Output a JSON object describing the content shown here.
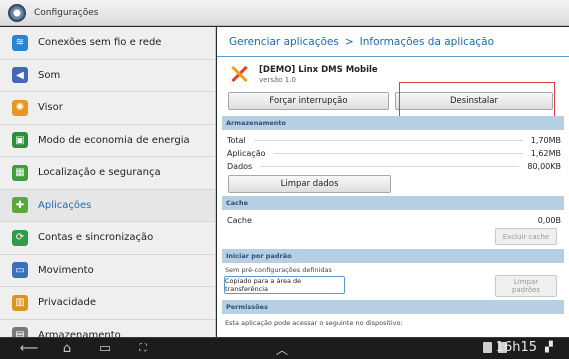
{
  "window": {
    "title": "Configurações"
  },
  "sidebar": {
    "items": [
      {
        "label": "Conexões sem fio e rede",
        "icon": "wifi-icon",
        "color": "#2a84d2",
        "glyph": "≋"
      },
      {
        "label": "Som",
        "icon": "speaker-icon",
        "color": "#4468b8",
        "glyph": "◀"
      },
      {
        "label": "Visor",
        "icon": "brightness-icon",
        "color": "#e8951d",
        "glyph": "✺"
      },
      {
        "label": "Modo de economia de energia",
        "icon": "power-save-icon",
        "color": "#2d8f3b",
        "glyph": "▣"
      },
      {
        "label": "Localização e segurança",
        "icon": "location-security-icon",
        "color": "#3f9d3a",
        "glyph": "▦"
      },
      {
        "label": "Aplicações",
        "icon": "applications-icon",
        "color": "#5aa83b",
        "glyph": "✚"
      },
      {
        "label": "Contas e sincronização",
        "icon": "sync-icon",
        "color": "#2f9c4a",
        "glyph": "⟳"
      },
      {
        "label": "Movimento",
        "icon": "motion-icon",
        "color": "#3b6fb8",
        "glyph": "▭"
      },
      {
        "label": "Privacidade",
        "icon": "privacy-icon",
        "color": "#d9951e",
        "glyph": "▥"
      },
      {
        "label": "Armazenamento",
        "icon": "storage-icon",
        "color": "#7a7a7a",
        "glyph": "▤"
      }
    ]
  },
  "breadcrumb": {
    "parent": "Gerenciar aplicações",
    "separator": ">",
    "current": "Informações da aplicação"
  },
  "app": {
    "name": "[DEMO] Linx DMS Mobile",
    "version": "versão 1.0"
  },
  "buttons": {
    "force_stop": "Forçar interrupção",
    "uninstall": "Desinstalar",
    "clear_data": "Limpar dados",
    "clear_cache": "Excluir cache",
    "copy_clipboard": "Copiado para a área de transferência",
    "clear_defaults": "Limpar padrões"
  },
  "storage": {
    "header": "Armazenamento",
    "rows": [
      {
        "label": "Total",
        "value": "1,70MB"
      },
      {
        "label": "Aplicação",
        "value": "1,62MB"
      },
      {
        "label": "Dados",
        "value": "80,00KB"
      }
    ]
  },
  "cache": {
    "header": "Cache",
    "label": "Cache",
    "value": "0,00B"
  },
  "defaults": {
    "header": "Iniciar por padrão",
    "note": "Sem pré-configurações definidas"
  },
  "permissions": {
    "header": "Permissões",
    "note": "Esta aplicação pode acessar o seguinte no dispositivo:"
  },
  "statusbar": {
    "time": "16h15"
  },
  "colors": {
    "accent": "#1a6bb5",
    "section_bg": "#b6cfe2",
    "highlight_frame": "#e23b3b"
  }
}
